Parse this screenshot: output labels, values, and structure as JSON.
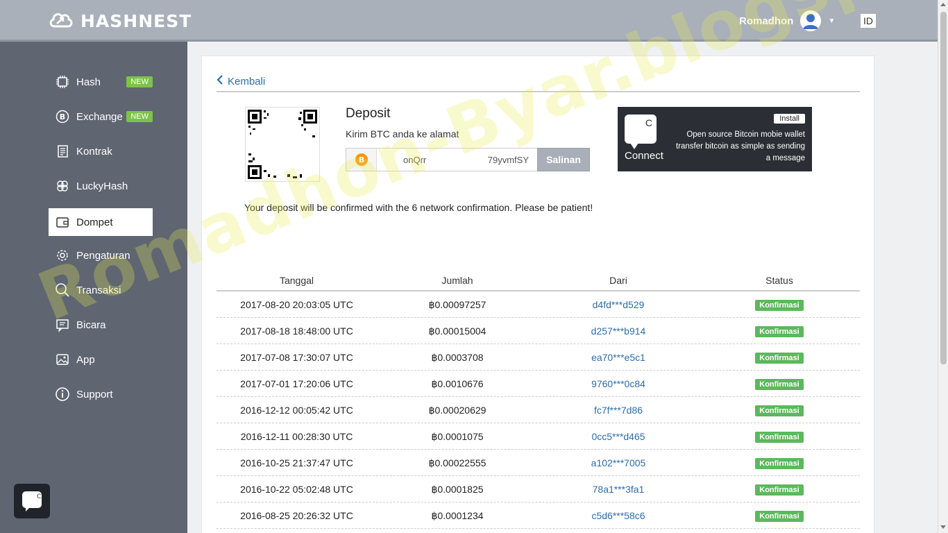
{
  "header": {
    "logo_text": "HASHNEST",
    "user_name": "Romadhon",
    "language": "ID"
  },
  "sidebar": {
    "items": [
      {
        "label": "Hash",
        "badge": "NEW",
        "icon": "chip-icon"
      },
      {
        "label": "Exchange",
        "badge": "NEW",
        "icon": "bitcoin-icon"
      },
      {
        "label": "Kontrak",
        "icon": "document-icon"
      },
      {
        "label": "LuckyHash",
        "icon": "clover-icon"
      },
      {
        "label": "Dompet",
        "icon": "wallet-icon",
        "active": true
      },
      {
        "label": "Pengaturan",
        "icon": "gear-icon"
      },
      {
        "label": "Transaksi",
        "icon": "search-icon"
      },
      {
        "label": "Bicara",
        "icon": "chat-icon"
      },
      {
        "label": "App",
        "icon": "image-icon"
      },
      {
        "label": "Support",
        "icon": "info-icon"
      }
    ]
  },
  "page": {
    "back_label": "Kembali",
    "deposit_title": "Deposit",
    "deposit_subtitle": "Kirim BTC anda ke alamat",
    "address_part1": "onQrr",
    "address_part2": "79yvmfSY",
    "copy_label": "Salinan",
    "notice": "Your deposit will be confirmed with the 6 network confirmation. Please be patient!"
  },
  "ad": {
    "install_label": "Install",
    "logo_letter": "C",
    "connect_label": "Connect",
    "description": "Open source Bitcoin mobie wallet transfer bitcoin as simple as sending a message"
  },
  "table": {
    "headers": [
      "Tanggal",
      "Jumlah",
      "Dari",
      "Status"
    ],
    "rows": [
      {
        "date": "2017-08-20 20:03:05 UTC",
        "amount": "฿0.00097257",
        "from": "d4fd***d529",
        "status": "Konfirmasi"
      },
      {
        "date": "2017-08-18 18:48:00 UTC",
        "amount": "฿0.00015004",
        "from": "d257***b914",
        "status": "Konfirmasi"
      },
      {
        "date": "2017-07-08 17:30:07 UTC",
        "amount": "฿0.0003708",
        "from": "ea70***e5c1",
        "status": "Konfirmasi"
      },
      {
        "date": "2017-07-01 17:20:06 UTC",
        "amount": "฿0.0010676",
        "from": "9760***0c84",
        "status": "Konfirmasi"
      },
      {
        "date": "2016-12-12 00:05:42 UTC",
        "amount": "฿0.00020629",
        "from": "fc7f***7d86",
        "status": "Konfirmasi"
      },
      {
        "date": "2016-12-11 00:28:30 UTC",
        "amount": "฿0.0001075",
        "from": "0cc5***d465",
        "status": "Konfirmasi"
      },
      {
        "date": "2016-10-25 21:37:47 UTC",
        "amount": "฿0.00022555",
        "from": "a102***7005",
        "status": "Konfirmasi"
      },
      {
        "date": "2016-10-22 05:02:48 UTC",
        "amount": "฿0.0001825",
        "from": "78a1***3fa1",
        "status": "Konfirmasi"
      },
      {
        "date": "2016-08-25 20:26:32 UTC",
        "amount": "฿0.0001234",
        "from": "c5d6***58c6",
        "status": "Konfirmasi"
      }
    ]
  },
  "chat_widget": {
    "letter": "C"
  },
  "watermark": "Romadhon-Byar.blogspot.com",
  "colors": {
    "sidebar": "#5f6672",
    "header": "#a9b0ba",
    "link": "#2b6cb0",
    "status": "#5cb85c",
    "badge": "#7dc24a"
  }
}
